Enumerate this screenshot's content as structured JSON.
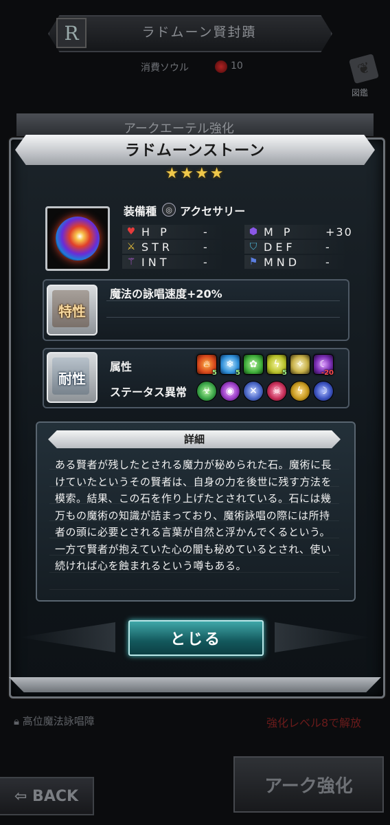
{
  "background": {
    "rank_badge": "R",
    "title": "ラドムーン賢封蹟",
    "soul_label": "消費ソウル",
    "soul_value": "10",
    "book_label": "図鑑",
    "strip_text": "アークエーテル強化",
    "locked_skill": "高位魔法詠唱障",
    "unlock_note": "強化レベル8で解放",
    "back_label": "BACK",
    "ark_button": "アーク強化"
  },
  "item": {
    "name": "ラドムーンストーン",
    "stars": "★★★★",
    "equip_type_label": "装備種",
    "equip_type_value": "アクセサリー",
    "equip_icon": "accessory-icon"
  },
  "stats": [
    {
      "name": "H P",
      "value": "-",
      "icon": "heart-icon",
      "color": "#e63b3b"
    },
    {
      "name": "M P",
      "value": "+30",
      "icon": "mp-icon",
      "color": "#8a57e6"
    },
    {
      "name": "STR",
      "value": "-",
      "icon": "sword-icon",
      "color": "#f0c53a"
    },
    {
      "name": "DEF",
      "value": "-",
      "icon": "shield-icon",
      "color": "#4fb7d8"
    },
    {
      "name": "INT",
      "value": "-",
      "icon": "staff-icon",
      "color": "#c463e6"
    },
    {
      "name": "MND",
      "value": "-",
      "icon": "mind-icon",
      "color": "#5b7ee0"
    }
  ],
  "trait": {
    "badge": "特性",
    "text": "魔法の詠唱速度+20%"
  },
  "resistance": {
    "badge": "耐性",
    "attribute_label": "属性",
    "status_label": "ステータス異常",
    "attributes": [
      {
        "icon": "fire-icon",
        "value": "5",
        "color": "#d8481c"
      },
      {
        "icon": "ice-icon",
        "value": "5",
        "color": "#2f8fd8"
      },
      {
        "icon": "wind-icon",
        "value": "",
        "color": "#3fae3a"
      },
      {
        "icon": "thunder-icon",
        "value": "5",
        "color": "#b7c02a"
      },
      {
        "icon": "light-icon",
        "value": "",
        "color": "#c9b24a"
      },
      {
        "icon": "dark-icon",
        "value": "-20",
        "color": "#7b2fb5"
      }
    ],
    "statuses": [
      {
        "icon": "poison-icon",
        "color": "#3da84a"
      },
      {
        "icon": "blind-icon",
        "color": "#9b3fc8"
      },
      {
        "icon": "silence-icon",
        "color": "#4b68c8"
      },
      {
        "icon": "charm-icon",
        "color": "#c82f5a"
      },
      {
        "icon": "paralyze-icon",
        "color": "#c89a1f"
      },
      {
        "icon": "sleep-icon",
        "color": "#3d54c2"
      }
    ]
  },
  "detail": {
    "title": "詳細",
    "text": "ある賢者が残したとされる魔力が秘められた石。魔術に長けていたというその賢者は、自身の力を後世に残す方法を模索。結果、この石を作り上げたとされている。石には幾万もの魔術の知識が詰まっており、魔術詠唱の際には所持者の頭に必要とされる言葉が自然と浮かんでくるという。一方で賢者が抱えていた心の闇も秘めているとされ、使い続ければ心を蝕まれるという噂もある。"
  },
  "close_label": "とじる"
}
